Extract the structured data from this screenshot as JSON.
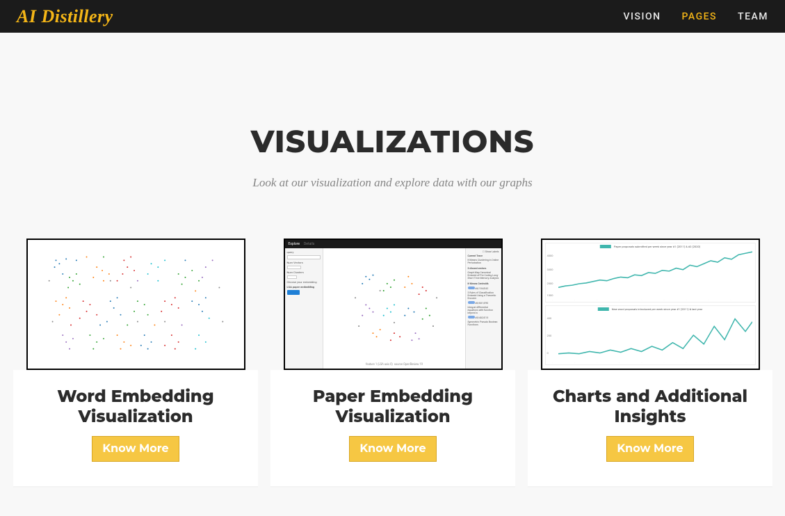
{
  "header": {
    "brand": "AI Distillery",
    "nav": [
      {
        "label": "VISION",
        "active": false
      },
      {
        "label": "PAGES",
        "active": true
      },
      {
        "label": "TEAM",
        "active": false
      }
    ]
  },
  "section": {
    "title": "VISUALIZATIONS",
    "subtitle": "Look at our visualization and explore data with our graphs"
  },
  "cards": [
    {
      "title": "Word Embedding Visualization",
      "button": "Know More"
    },
    {
      "title": "Paper Embedding Visualization",
      "button": "Know More"
    },
    {
      "title": "Charts and Additional Insights",
      "button": "Know More"
    }
  ]
}
